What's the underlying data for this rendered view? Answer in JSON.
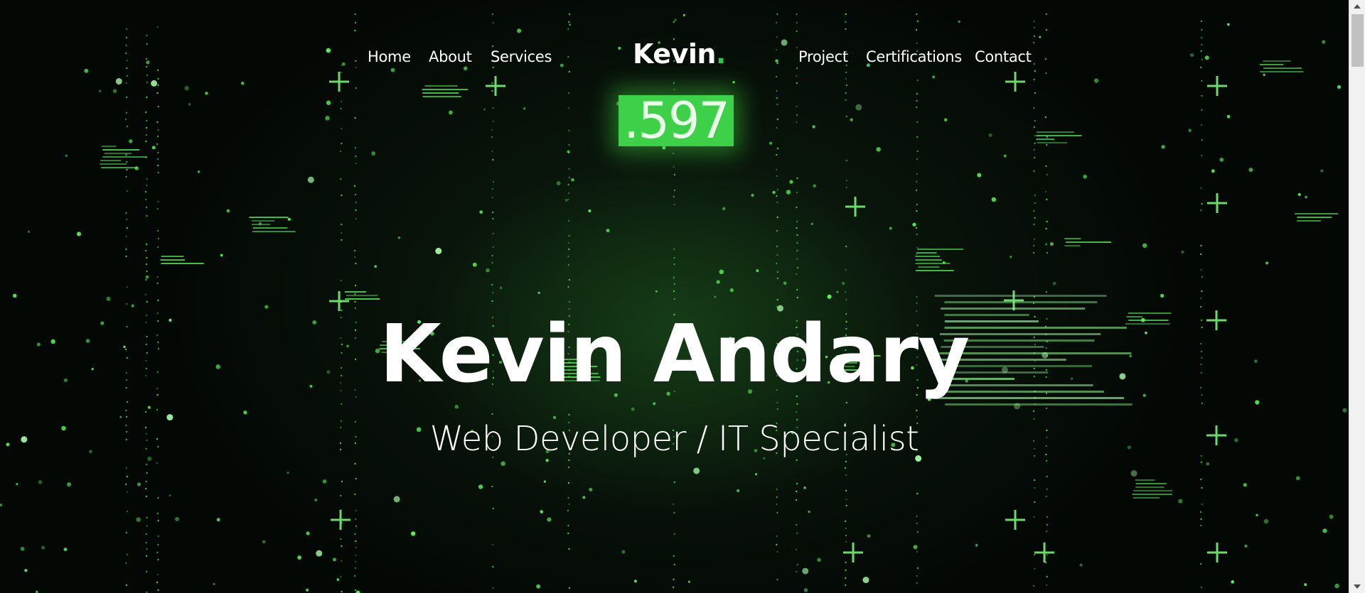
{
  "nav": {
    "left_links": [
      {
        "label": "Home"
      },
      {
        "label": "About"
      },
      {
        "label": "Services"
      }
    ],
    "brand": {
      "text": "Kevin",
      "dot": "."
    },
    "right_links": [
      {
        "label": "Project"
      },
      {
        "label": "Certifications"
      },
      {
        "label": "Contact"
      }
    ]
  },
  "hero": {
    "counter": ".597",
    "title": "Kevin Andary",
    "subtitle": "Web Developer / IT Specialist"
  },
  "colors": {
    "accent": "#36c24a",
    "background": "#050a06",
    "text": "#ffffff"
  }
}
